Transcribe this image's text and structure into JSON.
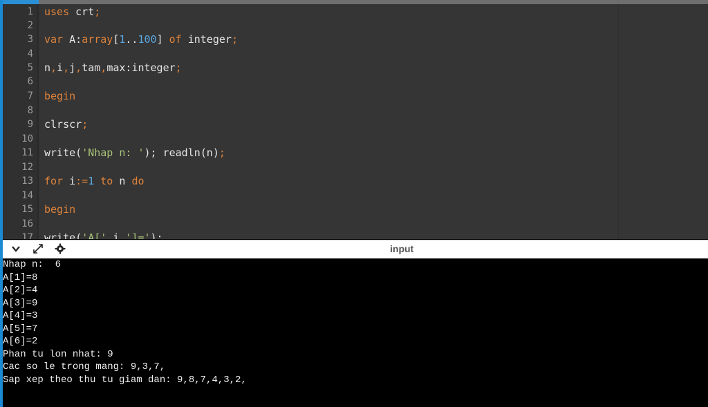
{
  "editor": {
    "lines": [
      {
        "n": "1",
        "tokens": [
          {
            "t": "uses",
            "c": "kw"
          },
          {
            "t": " crt",
            "c": "pl"
          },
          {
            "t": ";",
            "c": "kw"
          }
        ]
      },
      {
        "n": "2",
        "tokens": []
      },
      {
        "n": "3",
        "tokens": [
          {
            "t": "var",
            "c": "kw"
          },
          {
            "t": " A:",
            "c": "pl"
          },
          {
            "t": "array",
            "c": "kw"
          },
          {
            "t": "[",
            "c": "pl"
          },
          {
            "t": "1",
            "c": "num"
          },
          {
            "t": "..",
            "c": "pl"
          },
          {
            "t": "100",
            "c": "num"
          },
          {
            "t": "] ",
            "c": "pl"
          },
          {
            "t": "of",
            "c": "kw"
          },
          {
            "t": " integer",
            "c": "pl"
          },
          {
            "t": ";",
            "c": "kw"
          }
        ]
      },
      {
        "n": "4",
        "tokens": []
      },
      {
        "n": "5",
        "tokens": [
          {
            "t": "n",
            "c": "pl"
          },
          {
            "t": ",",
            "c": "kw"
          },
          {
            "t": "i",
            "c": "pl"
          },
          {
            "t": ",",
            "c": "kw"
          },
          {
            "t": "j",
            "c": "pl"
          },
          {
            "t": ",",
            "c": "kw"
          },
          {
            "t": "tam",
            "c": "pl"
          },
          {
            "t": ",",
            "c": "kw"
          },
          {
            "t": "max:integer",
            "c": "pl"
          },
          {
            "t": ";",
            "c": "kw"
          }
        ]
      },
      {
        "n": "6",
        "tokens": []
      },
      {
        "n": "7",
        "tokens": [
          {
            "t": "begin",
            "c": "kw"
          }
        ]
      },
      {
        "n": "8",
        "tokens": []
      },
      {
        "n": "9",
        "tokens": [
          {
            "t": "clrscr",
            "c": "pl"
          },
          {
            "t": ";",
            "c": "kw"
          }
        ]
      },
      {
        "n": "10",
        "tokens": []
      },
      {
        "n": "11",
        "tokens": [
          {
            "t": "write(",
            "c": "pl"
          },
          {
            "t": "'Nhap n: '",
            "c": "str"
          },
          {
            "t": "); readln(n)",
            "c": "pl"
          },
          {
            "t": ";",
            "c": "kw"
          }
        ]
      },
      {
        "n": "12",
        "tokens": []
      },
      {
        "n": "13",
        "tokens": [
          {
            "t": "for",
            "c": "kw"
          },
          {
            "t": " i",
            "c": "pl"
          },
          {
            "t": ":=",
            "c": "kw"
          },
          {
            "t": "1",
            "c": "num"
          },
          {
            "t": " ",
            "c": "pl"
          },
          {
            "t": "to",
            "c": "kw"
          },
          {
            "t": " n ",
            "c": "pl"
          },
          {
            "t": "do",
            "c": "kw"
          }
        ]
      },
      {
        "n": "14",
        "tokens": []
      },
      {
        "n": "15",
        "tokens": [
          {
            "t": "begin",
            "c": "kw"
          }
        ]
      },
      {
        "n": "16",
        "tokens": []
      },
      {
        "n": "17",
        "tokens": [
          {
            "t": "write(",
            "c": "pl"
          },
          {
            "t": "'A['",
            "c": "str"
          },
          {
            "t": ",i,",
            "c": "pl"
          },
          {
            "t": "']='",
            "c": "str"
          },
          {
            "t": ");",
            "c": "pl"
          }
        ]
      }
    ]
  },
  "panel": {
    "title": "input",
    "icons": [
      "chevron-down-icon",
      "expand-icon",
      "settings-icon"
    ]
  },
  "console": {
    "lines": [
      "Nhap n:  6",
      "A[1]=8",
      "A[2]=4",
      "A[3]=9",
      "A[4]=3",
      "A[5]=7",
      "A[6]=2",
      "Phan tu lon nhat: 9",
      "Cac so le trong mang: 9,3,7,",
      "Sap xep theo thu tu giam dan: 9,8,7,4,3,2,"
    ]
  }
}
